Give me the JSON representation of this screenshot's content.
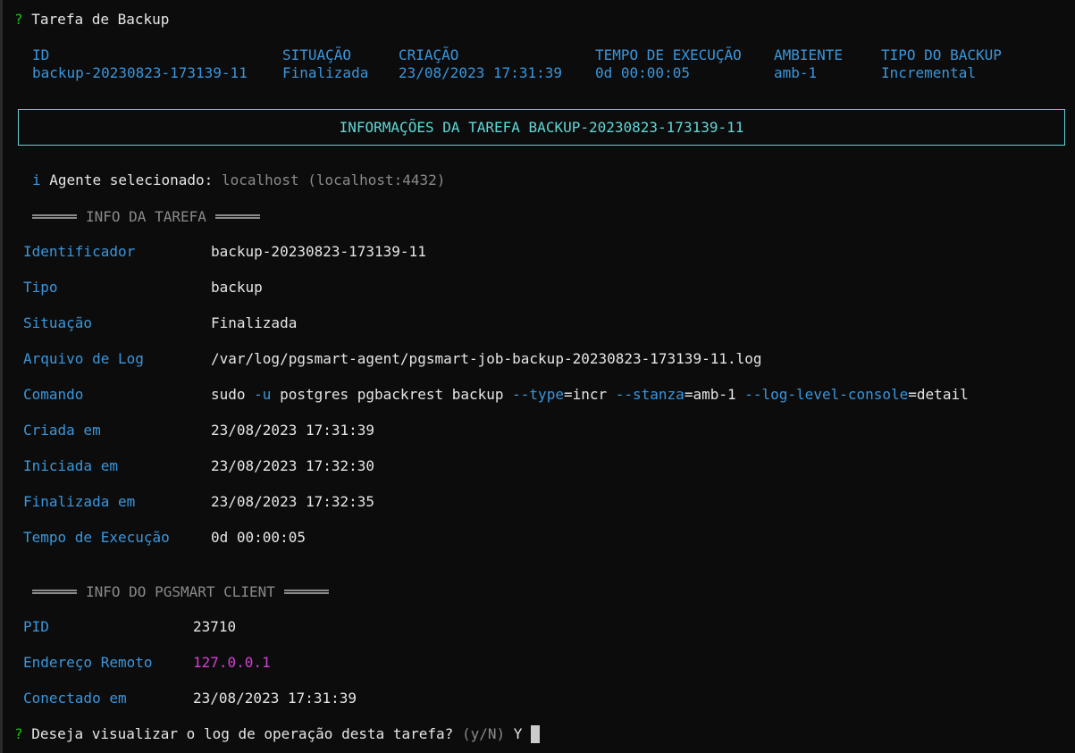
{
  "prompt_title": {
    "mark": "?",
    "text": "Tarefa de Backup"
  },
  "summary": {
    "headers": [
      "ID",
      "SITUAÇÃO",
      "CRIAÇÃO",
      "TEMPO DE EXECUÇÃO",
      "AMBIENTE",
      "TIPO DO BACKUP"
    ],
    "values": [
      "backup-20230823-173139-11",
      "Finalizada",
      "23/08/2023 17:31:39",
      "0d 00:00:05",
      "amb-1",
      "Incremental"
    ]
  },
  "box_title": "INFORMAÇÕES DA TAREFA BACKUP-20230823-173139-11",
  "agent": {
    "icon": "i",
    "label": "Agente selecionado:",
    "value": "localhost (localhost:4432)"
  },
  "task_section": {
    "title": "INFO DA TAREFA",
    "rows": [
      {
        "label": "Identificador",
        "value": "backup-20230823-173139-11"
      },
      {
        "label": "Tipo",
        "value": "backup"
      },
      {
        "label": "Situação",
        "value": "Finalizada"
      },
      {
        "label": "Arquivo de Log",
        "value": "/var/log/pgsmart-agent/pgsmart-job-backup-20230823-173139-11.log"
      },
      {
        "label": "Comando",
        "value": ""
      },
      {
        "label": "Criada em",
        "value": "23/08/2023 17:31:39"
      },
      {
        "label": "Iniciada em",
        "value": "23/08/2023 17:32:30"
      },
      {
        "label": "Finalizada em",
        "value": "23/08/2023 17:32:35"
      },
      {
        "label": "Tempo de Execução",
        "value": "0d 00:00:05"
      }
    ],
    "command": {
      "p1": "sudo ",
      "f1": "-u",
      "p2": " postgres pgbackrest backup ",
      "f2": "--type",
      "p3": "=incr ",
      "f3": "--stanza",
      "p4": "=amb-1 ",
      "f4": "--log-level-console",
      "p5": "=detail"
    }
  },
  "client_section": {
    "title": "INFO DO PGSMART CLIENT",
    "rows": [
      {
        "label": "PID",
        "value": "23710"
      },
      {
        "label": "Endereço Remoto",
        "value": "127.0.0.1"
      },
      {
        "label": "Conectado em",
        "value": "23/08/2023 17:31:39"
      }
    ]
  },
  "question": {
    "mark": "?",
    "text": "Deseja visualizar o log de operação desta tarefa?",
    "hint": "(y/N)",
    "answer": "Y"
  },
  "colors": {
    "background": "#0c0c0c",
    "prompt_green": "#16c60c",
    "label_blue": "#3a96dd",
    "header_cyan": "#61d6d6",
    "address_magenta": "#d63fd6"
  }
}
